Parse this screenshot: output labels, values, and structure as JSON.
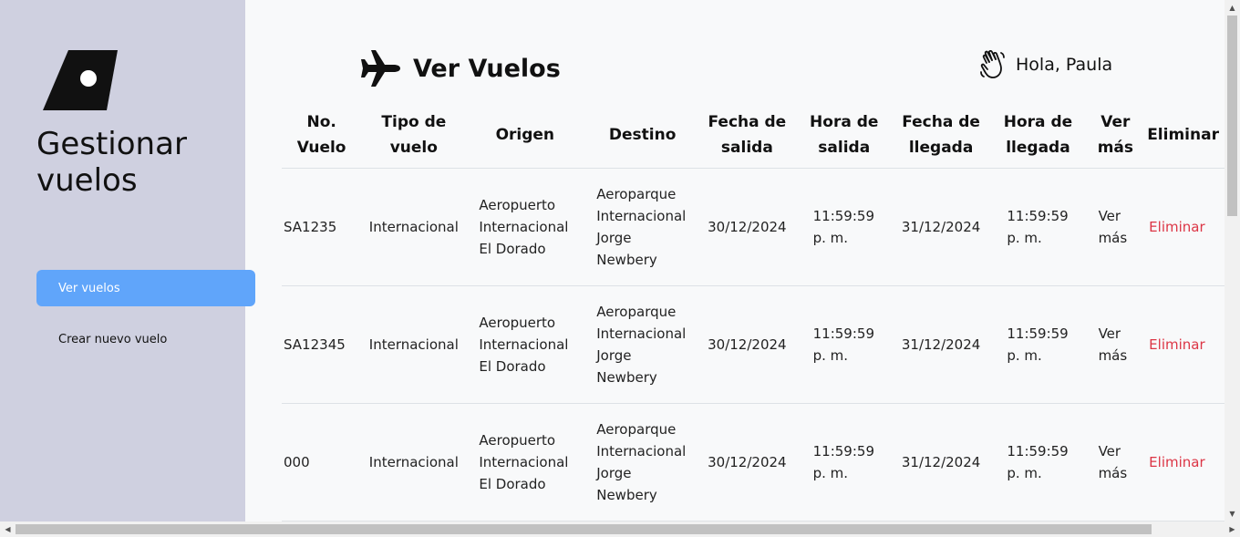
{
  "sidebar": {
    "title": "Gestionar vuelos",
    "nav": [
      {
        "label": "Ver vuelos",
        "active": true
      },
      {
        "label": "Crear nuevo vuelo",
        "active": false
      }
    ],
    "background": "#cfd0e0",
    "accent": "#60a5fa"
  },
  "header": {
    "title": "Ver Vuelos",
    "title_icon": "airplane-icon",
    "greeting": "Hola, Paula",
    "greeting_icon": "waving-hand-icon"
  },
  "table": {
    "columns": [
      "No. Vuelo",
      "Tipo de vuelo",
      "Origen",
      "Destino",
      "Fecha de salida",
      "Hora de salida",
      "Fecha de llegada",
      "Hora de llegada",
      "Ver más",
      "Eliminar"
    ],
    "rows": [
      {
        "numero": "SA1235",
        "tipo": "Internacional",
        "origen": "Aeropuerto Internacional El Dorado",
        "destino": "Aeroparque Internacional Jorge Newbery",
        "fecha_salida": "30/12/2024",
        "hora_salida": "11:59:59 p. m.",
        "fecha_llegada": "31/12/2024",
        "hora_llegada": "11:59:59 p. m.",
        "ver_mas": "Ver más",
        "eliminar": "Eliminar"
      },
      {
        "numero": "SA12345",
        "tipo": "Internacional",
        "origen": "Aeropuerto Internacional El Dorado",
        "destino": "Aeroparque Internacional Jorge Newbery",
        "fecha_salida": "30/12/2024",
        "hora_salida": "11:59:59 p. m.",
        "fecha_llegada": "31/12/2024",
        "hora_llegada": "11:59:59 p. m.",
        "ver_mas": "Ver más",
        "eliminar": "Eliminar"
      },
      {
        "numero": "000",
        "tipo": "Internacional",
        "origen": "Aeropuerto Internacional El Dorado",
        "destino": "Aeroparque Internacional Jorge Newbery",
        "fecha_salida": "30/12/2024",
        "hora_salida": "11:59:59 p. m.",
        "fecha_llegada": "31/12/2024",
        "hora_llegada": "11:59:59 p. m.",
        "ver_mas": "Ver más",
        "eliminar": "Eliminar"
      }
    ],
    "delete_color": "#dc3545"
  }
}
